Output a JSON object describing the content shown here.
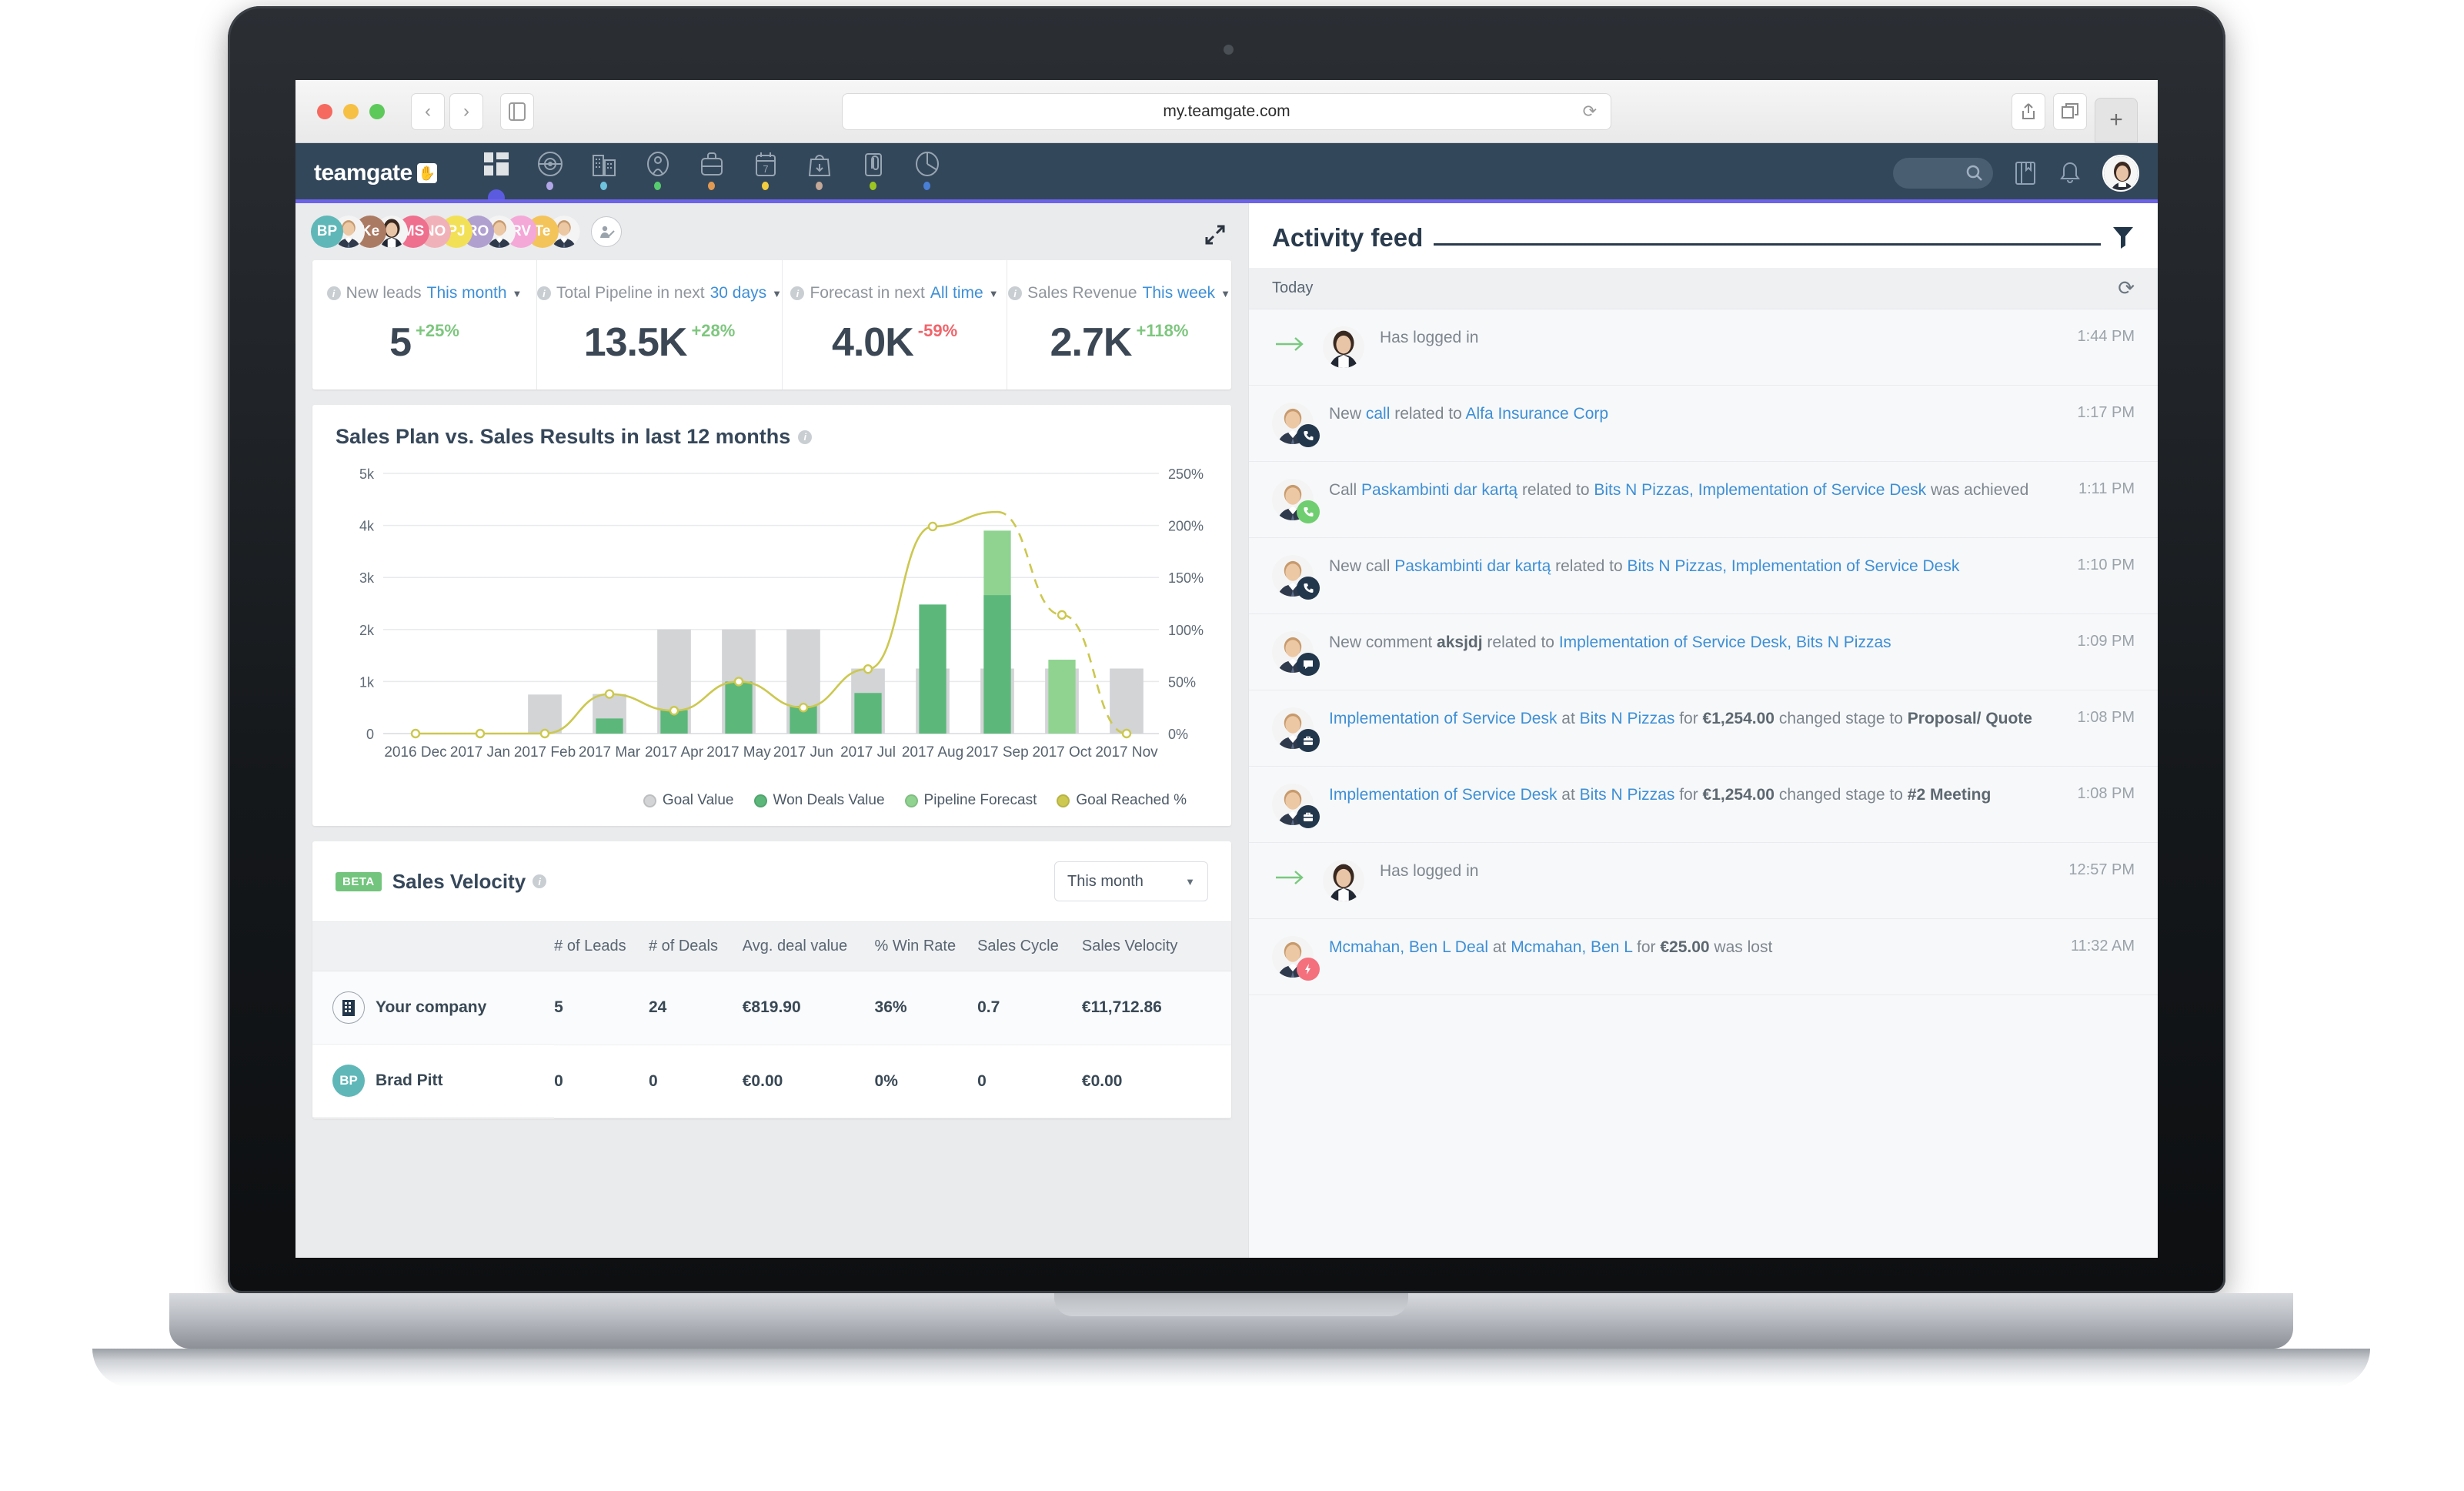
{
  "browser": {
    "url": "my.teamgate.com",
    "back_icon": "chevron-left-icon",
    "forward_icon": "chevron-right-icon",
    "sidebar_icon": "sidebar-toggle-icon",
    "reload_icon": "reload-icon",
    "share_icon": "share-icon",
    "tabs_icon": "show-tabs-icon",
    "new_tab_icon": "plus-icon"
  },
  "topnav": {
    "logo_text": "teamgate",
    "items": [
      {
        "name": "dashboard",
        "icon": "dashboard-grid-icon",
        "dot": "",
        "active": true
      },
      {
        "name": "leads",
        "icon": "target-icon",
        "dot": "#b1a7e8"
      },
      {
        "name": "companies",
        "icon": "building-icon",
        "dot": "#6ec3dd"
      },
      {
        "name": "contacts",
        "icon": "person-icon",
        "dot": "#56cc6e"
      },
      {
        "name": "deals",
        "icon": "briefcase-icon",
        "dot": "#e29a52"
      },
      {
        "name": "calendar",
        "icon": "calendar-icon",
        "dot": "#f2cd3e"
      },
      {
        "name": "sales",
        "icon": "bag-down-arrow-icon",
        "dot": "#c4a898"
      },
      {
        "name": "tasks",
        "icon": "clipboard-clip-icon",
        "dot": "#9dc520"
      },
      {
        "name": "insights",
        "icon": "pie-chart-icon",
        "dot": "#4a7fd6"
      }
    ],
    "search_placeholder": "",
    "search_icon": "search-icon",
    "book_icon": "knowledge-base-icon",
    "bell_icon": "notifications-bell-icon",
    "avatar": "user-avatar"
  },
  "team": {
    "expand_icon": "expand-fullscreen-icon",
    "add_user_icon": "add-user-icon",
    "members": [
      {
        "initials": "BP",
        "color": "#5fb7b8",
        "photo": false
      },
      {
        "initials": "",
        "color": "#dcdcdc",
        "photo": true
      },
      {
        "initials": "Ke",
        "color": "#ab7a63",
        "photo": false
      },
      {
        "initials": "",
        "color": "#dcdcdc",
        "photo": true
      },
      {
        "initials": "MS",
        "color": "#ef6f8e",
        "photo": false
      },
      {
        "initials": "NO",
        "color": "#f0b2b8",
        "photo": false
      },
      {
        "initials": "PJ",
        "color": "#f2e056",
        "photo": false
      },
      {
        "initials": "RO",
        "color": "#b0a0d0",
        "photo": false
      },
      {
        "initials": "",
        "color": "#dcdcdc",
        "photo": true
      },
      {
        "initials": "RV",
        "color": "#f4a8d8",
        "photo": false
      },
      {
        "initials": "Te",
        "color": "#f3c45a",
        "photo": false
      },
      {
        "initials": "",
        "color": "#c9c9c9",
        "photo": true
      }
    ]
  },
  "kpis": [
    {
      "name": "new-leads",
      "label": "New leads",
      "period": "This month",
      "value": "5",
      "delta": "+25%",
      "direction": "up"
    },
    {
      "name": "total-pipeline",
      "label": "Total Pipeline in next",
      "period": "30 days",
      "value": "13.5K",
      "delta": "+28%",
      "direction": "up"
    },
    {
      "name": "forecast",
      "label": "Forecast in next",
      "period": "All time",
      "value": "4.0K",
      "delta": "-59%",
      "direction": "down"
    },
    {
      "name": "sales-revenue",
      "label": "Sales Revenue",
      "period": "This week",
      "value": "2.7K",
      "delta": "+118%",
      "direction": "up"
    }
  ],
  "chart_card": {
    "title": "Sales Plan vs. Sales Results in last 12 months",
    "info_icon": "info-icon"
  },
  "chart_data": {
    "type": "bar",
    "title": "Sales Plan vs. Sales Results in last 12 months",
    "xlabel": "",
    "ylabel": "",
    "ylim": [
      0,
      5000
    ],
    "y_ticks": [
      "0",
      "1k",
      "2k",
      "3k",
      "4k",
      "5k"
    ],
    "y2lim": [
      0,
      250
    ],
    "y2_ticks": [
      "0%",
      "50%",
      "100%",
      "150%",
      "200%",
      "250%"
    ],
    "grid": true,
    "legend_position": "bottom-right",
    "categories": [
      "2016 Dec",
      "2017 Jan",
      "2017 Feb",
      "2017 Mar",
      "2017 Apr",
      "2017 May",
      "2017 Jun",
      "2017 Jul",
      "2017 Aug",
      "2017 Sep",
      "2017 Oct",
      "2017 Nov"
    ],
    "series": [
      {
        "name": "Goal Value",
        "color": "#d2d4d6",
        "values": [
          0,
          0,
          750,
          760,
          2000,
          2000,
          2000,
          1250,
          1250,
          1250,
          1250,
          1250
        ]
      },
      {
        "name": "Won Deals Value",
        "color": "#5cb77b",
        "values": [
          0,
          0,
          0,
          290,
          450,
          1000,
          530,
          780,
          2480,
          2660,
          0,
          0
        ]
      },
      {
        "name": "Pipeline Forecast",
        "color": "#90d391",
        "values": [
          0,
          0,
          0,
          0,
          0,
          0,
          0,
          0,
          0,
          3900,
          1420,
          0
        ]
      },
      {
        "name": "Goal Reached %",
        "color": "#ccc850",
        "type": "line",
        "values": [
          0,
          0,
          0,
          38,
          22,
          50,
          25,
          62,
          199,
          213,
          114,
          0
        ],
        "dashed_from": "2017 Sep"
      }
    ]
  },
  "velocity": {
    "badge": "BETA",
    "title": "Sales Velocity",
    "info_icon": "info-icon",
    "period": "This month",
    "caret_icon": "chevron-down-icon",
    "columns": [
      "",
      "# of Leads",
      "# of Deals",
      "Avg. deal value",
      "% Win Rate",
      "Sales Cycle",
      "Sales Velocity"
    ],
    "rows": [
      {
        "name": "Your company",
        "avatar_type": "company",
        "initials": "",
        "color": "#ffffff",
        "leads": "5",
        "deals": "24",
        "avg_deal": "€819.90",
        "win_rate": "36%",
        "cycle": "0.7",
        "velocity": "€11,712.86"
      },
      {
        "name": "Brad Pitt",
        "avatar_type": "initials",
        "initials": "BP",
        "color": "#5fb7b8",
        "leads": "0",
        "deals": "0",
        "avg_deal": "€0.00",
        "win_rate": "0%",
        "cycle": "0",
        "velocity": "€0.00"
      }
    ]
  },
  "feed": {
    "title": "Activity feed",
    "filter_icon": "filter-funnel-icon",
    "group_label": "Today",
    "refresh_icon": "refresh-icon",
    "items": [
      {
        "badge": "",
        "badge_color": "",
        "avatar": "female",
        "arrow": true,
        "parts": [
          {
            "t": "Has logged in",
            "s": "plain"
          }
        ],
        "time": "1:44 PM"
      },
      {
        "badge": "phone-icon",
        "badge_color": "#22374c",
        "avatar": "male",
        "arrow": false,
        "parts": [
          {
            "t": "New ",
            "s": "plain"
          },
          {
            "t": "call",
            "s": "link"
          },
          {
            "t": " related to ",
            "s": "plain"
          },
          {
            "t": "Alfa Insurance Corp",
            "s": "link"
          }
        ],
        "time": "1:17 PM"
      },
      {
        "badge": "phone-icon",
        "badge_color": "#6fce6f",
        "avatar": "male",
        "arrow": false,
        "parts": [
          {
            "t": "Call ",
            "s": "plain"
          },
          {
            "t": "Paskambinti dar kartą",
            "s": "link"
          },
          {
            "t": " related to ",
            "s": "plain"
          },
          {
            "t": "Bits N Pizzas, Implementation of Service Desk",
            "s": "link"
          },
          {
            "t": " was achieved",
            "s": "plain"
          }
        ],
        "time": "1:11 PM"
      },
      {
        "badge": "phone-icon",
        "badge_color": "#22374c",
        "avatar": "male",
        "arrow": false,
        "parts": [
          {
            "t": "New call ",
            "s": "plain"
          },
          {
            "t": "Paskambinti dar kartą",
            "s": "link"
          },
          {
            "t": " related to ",
            "s": "plain"
          },
          {
            "t": "Bits N Pizzas, Implementation of Service Desk",
            "s": "link"
          }
        ],
        "time": "1:10 PM"
      },
      {
        "badge": "comment-icon",
        "badge_color": "#22374c",
        "avatar": "male",
        "arrow": false,
        "parts": [
          {
            "t": "New comment ",
            "s": "plain"
          },
          {
            "t": "aksjdj",
            "s": "bold"
          },
          {
            "t": " related to ",
            "s": "plain"
          },
          {
            "t": "Implementation of Service Desk, Bits N Pizzas",
            "s": "link"
          }
        ],
        "time": "1:09 PM"
      },
      {
        "badge": "briefcase-icon",
        "badge_color": "#22374c",
        "avatar": "male",
        "arrow": false,
        "parts": [
          {
            "t": "Implementation of Service Desk",
            "s": "link"
          },
          {
            "t": " at ",
            "s": "plain"
          },
          {
            "t": "Bits N Pizzas",
            "s": "link"
          },
          {
            "t": " for ",
            "s": "plain"
          },
          {
            "t": "€1,254.00",
            "s": "bold"
          },
          {
            "t": " changed stage to ",
            "s": "plain"
          },
          {
            "t": "Proposal/ Quote",
            "s": "bold"
          }
        ],
        "time": "1:08 PM"
      },
      {
        "badge": "briefcase-icon",
        "badge_color": "#22374c",
        "avatar": "male",
        "arrow": false,
        "parts": [
          {
            "t": "Implementation of Service Desk",
            "s": "link"
          },
          {
            "t": " at ",
            "s": "plain"
          },
          {
            "t": "Bits N Pizzas",
            "s": "link"
          },
          {
            "t": " for ",
            "s": "plain"
          },
          {
            "t": "€1,254.00",
            "s": "bold"
          },
          {
            "t": " changed stage to ",
            "s": "plain"
          },
          {
            "t": "#2 Meeting",
            "s": "bold"
          }
        ],
        "time": "1:08 PM"
      },
      {
        "badge": "",
        "badge_color": "",
        "avatar": "female",
        "arrow": true,
        "parts": [
          {
            "t": "Has logged in",
            "s": "plain"
          }
        ],
        "time": "12:57 PM"
      },
      {
        "badge": "bolt-icon",
        "badge_color": "#f4707d",
        "avatar": "male",
        "arrow": false,
        "parts": [
          {
            "t": "Mcmahan, Ben L Deal",
            "s": "link"
          },
          {
            "t": " at ",
            "s": "plain"
          },
          {
            "t": "Mcmahan, Ben L",
            "s": "link"
          },
          {
            "t": " for ",
            "s": "plain"
          },
          {
            "t": "€25.00",
            "s": "bold"
          },
          {
            "t": " was lost",
            "s": "plain"
          }
        ],
        "time": "11:32 AM"
      }
    ]
  }
}
